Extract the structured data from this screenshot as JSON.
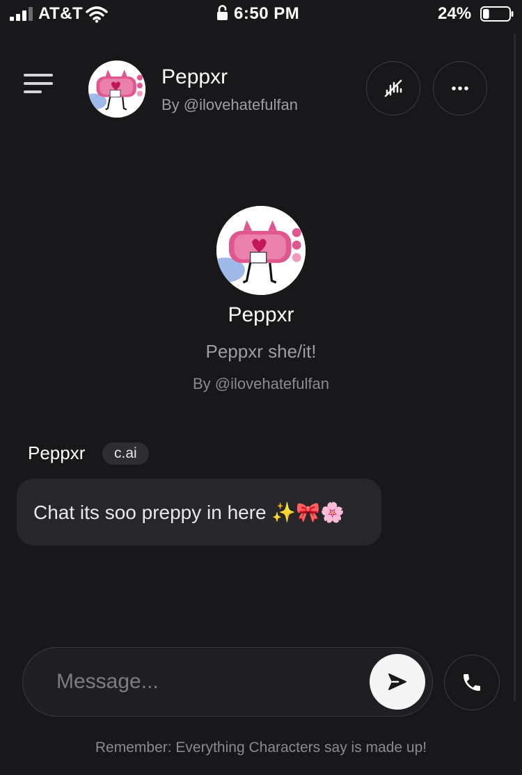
{
  "status_bar": {
    "carrier": "AT&T",
    "time": "6:50 PM",
    "battery_percent": "24%",
    "battery_level": 0.24,
    "signal_bars_active": 3,
    "icons": [
      "signal-icon",
      "wifi-icon",
      "lock-icon",
      "battery-icon"
    ]
  },
  "header": {
    "character_name": "Peppxr",
    "author": "By @ilovehatefulfan",
    "icons": [
      "menu-icon",
      "mute-icon",
      "more-icon"
    ]
  },
  "intro": {
    "name": "Peppxr",
    "tagline": "Peppxr she/it!",
    "author": "By @ilovehatefulfan"
  },
  "messages": [
    {
      "sender": "Peppxr",
      "badge": "c.ai",
      "text": "Chat its soo preppy in here ✨🎀🌸"
    }
  ],
  "composer": {
    "placeholder": "Message...",
    "icons": [
      "send-icon",
      "phone-icon"
    ]
  },
  "footer": {
    "disclaimer": "Remember: Everything Characters say is made up!"
  },
  "colors": {
    "background": "#18181b",
    "bubble": "#27272b",
    "muted_text": "#9d9da3",
    "avatar_pink": "#e0568e"
  }
}
